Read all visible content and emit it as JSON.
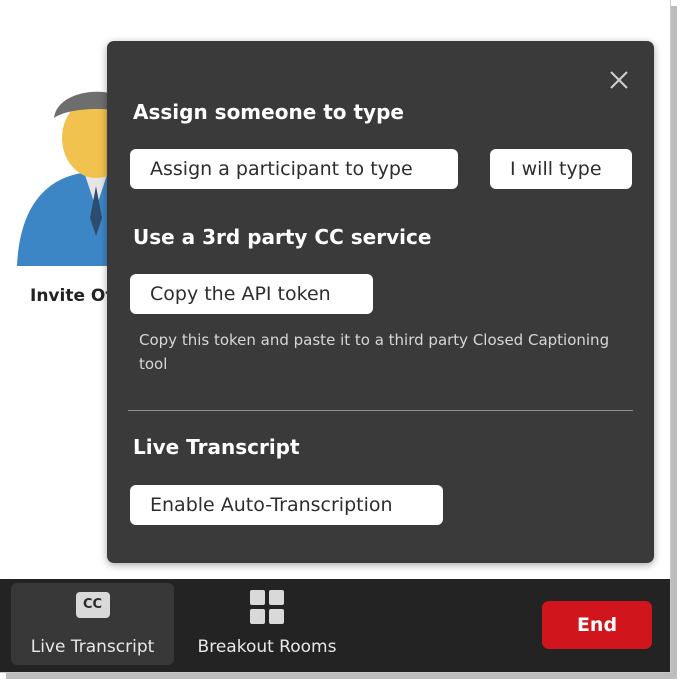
{
  "participant": {
    "invite_label": "Invite Oth"
  },
  "cc_popup": {
    "assign_section_title": "Assign someone to type",
    "assign_participant_button": "Assign a participant to type",
    "i_will_type_button": "I will type",
    "third_party_section_title": "Use a 3rd party CC service",
    "copy_api_token_button": "Copy the API token",
    "copy_token_helper": "Copy this token and paste it to a third party Closed Captioning tool",
    "live_transcript_section_title": "Live Transcript",
    "enable_auto_transcription_button": "Enable Auto-Transcription"
  },
  "toolbar": {
    "live_transcript_icon_text": "CC",
    "live_transcript_label": "Live Transcript",
    "breakout_rooms_label": "Breakout Rooms",
    "end_label": "End"
  },
  "colors": {
    "popup_bg": "#3a3a3a",
    "toolbar_bg": "#232323",
    "end_button": "#d0161c"
  },
  "icons": {
    "close": "close-icon",
    "avatar": "person-avatar-icon",
    "live_transcript": "cc-icon",
    "breakout_rooms": "grid-icon"
  }
}
